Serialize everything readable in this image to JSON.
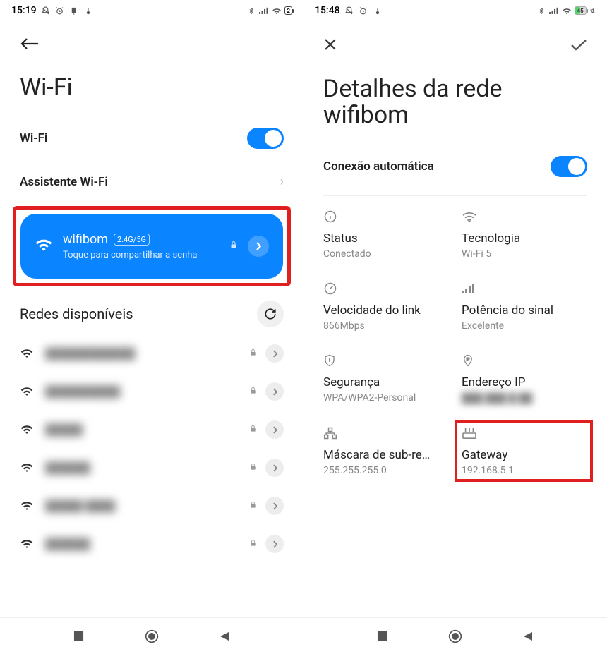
{
  "left": {
    "status": {
      "time": "15:19",
      "battery": "2"
    },
    "title": "Wi-Fi",
    "wifi_label": "Wi-Fi",
    "assistant_label": "Assistente Wi-Fi",
    "card": {
      "ssid": "wifibom",
      "band_badge": "2.4G/5G",
      "subtitle": "Toque para compartilhar a senha"
    },
    "available_title": "Redes disponíveis",
    "networks": [
      {
        "name": "████████████"
      },
      {
        "name": "██████████"
      },
      {
        "name": "█████"
      },
      {
        "name": "██████"
      },
      {
        "name": "█████ ████"
      },
      {
        "name": "██████"
      }
    ]
  },
  "right": {
    "status": {
      "time": "15:48",
      "battery": "45"
    },
    "title": "Detalhes da rede wifibom",
    "auto_label": "Conexão automática",
    "details": {
      "status": {
        "label": "Status",
        "value": "Conectado"
      },
      "tech": {
        "label": "Tecnologia",
        "value": "Wi-Fi 5"
      },
      "link": {
        "label": "Velocidade do link",
        "value": "866Mbps"
      },
      "signal": {
        "label": "Potência do sinal",
        "value": "Excelente"
      },
      "security": {
        "label": "Segurança",
        "value": "WPA/WPA2-Personal"
      },
      "ip": {
        "label": "Endereço IP",
        "value": "███.███.█.██"
      },
      "subnet": {
        "label": "Máscara de sub-re…",
        "value": "255.255.255.0"
      },
      "gateway": {
        "label": "Gateway",
        "value": "192.168.5.1"
      }
    }
  }
}
